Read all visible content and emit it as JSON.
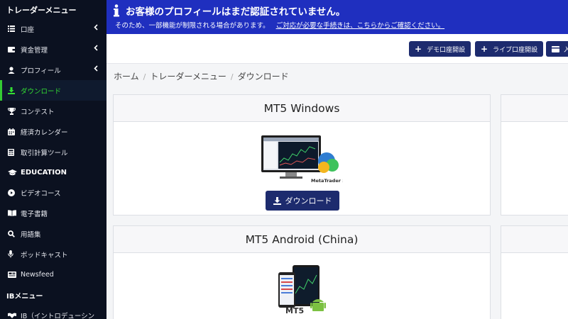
{
  "sidebar": {
    "header": "トレーダーメニュー",
    "items": [
      {
        "label": "口座",
        "chevron": "‹"
      },
      {
        "label": "資金管理",
        "chevron": "‹"
      },
      {
        "label": "プロフィール",
        "chevron": "‹"
      },
      {
        "label": "ダウンロード"
      },
      {
        "label": "コンテスト"
      },
      {
        "label": "経済カレンダー"
      },
      {
        "label": "取引計算ツール"
      }
    ],
    "education_header": "EDUCATION",
    "edu_items": [
      {
        "label": "ビデオコース"
      },
      {
        "label": "電子書籍"
      },
      {
        "label": "用語集"
      },
      {
        "label": "ポッドキャスト"
      },
      {
        "label": "Newsfeed"
      }
    ],
    "ib_header": "IBメニュー",
    "ib_items": [
      {
        "label": "IB（イントロデューシン"
      }
    ]
  },
  "banner": {
    "title": "お客様のプロフィールはまだ認証されていません。",
    "message": "そのため、一部機能が制限される場合があります。",
    "link": "ご対応が必要な手続きは、こちらからご確認ください。",
    "color": "#1f2fbf"
  },
  "topbar": {
    "demo_button": "デモ口座開設",
    "live_button": "ライブ口座開設",
    "third_button": "入"
  },
  "breadcrumb": [
    "ホーム",
    "トレーダーメニュー",
    "ダウンロード"
  ],
  "cards": [
    {
      "title": "MT5 Windows",
      "button": "ダウンロード",
      "logo_text": "MetaTrader 5"
    },
    {
      "title": "MT5 Android (China)",
      "logo_text": "MT5"
    }
  ],
  "colors": {
    "accent": "#1d2b6e",
    "active": "#33cc33",
    "sidebar_bg": "#0b1120"
  }
}
